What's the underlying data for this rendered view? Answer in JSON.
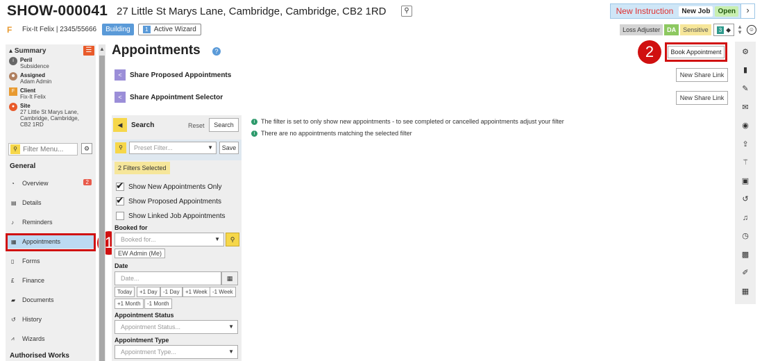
{
  "header": {
    "job_id": "SHOW-000041",
    "address": "27 Little St Marys Lane, Cambridge, Cambridge, CB2 1RD",
    "new_instruction": "New Instruction",
    "new_job": "New Job",
    "status": "Open",
    "client_line": "Fix-It Felix | 2345/55666",
    "building": "Building",
    "active_wizard": "Active Wizard",
    "active_wizard_num": "1",
    "tags": {
      "loss_adjuster": "Loss Adjuster",
      "da": "DA",
      "sensitive": "Sensitive",
      "count": "3"
    }
  },
  "summary": {
    "title": "Summary",
    "peril_label": "Peril",
    "peril_value": "Subsidence",
    "assigned_label": "Assigned",
    "assigned_value": "Adam Admin",
    "client_label": "Client",
    "client_value": "Fix-It Felix",
    "site_label": "Site",
    "site_line1": "27 Little St Marys Lane,",
    "site_line2": "Cambridge, Cambridge,",
    "site_line3": "CB2 1RD"
  },
  "filter_menu": {
    "placeholder": "Filter Menu..."
  },
  "nav": {
    "general": "General",
    "overview": "Overview",
    "overview_badge": "2",
    "details": "Details",
    "reminders": "Reminders",
    "appointments": "Appointments",
    "forms": "Forms",
    "finance": "Finance",
    "documents": "Documents",
    "history": "History",
    "wizards": "Wizards",
    "authorised_works": "Authorised Works"
  },
  "callouts": {
    "one": "1",
    "two": "2"
  },
  "main": {
    "title": "Appointments",
    "book_appointment": "Book Appointment",
    "share_proposed": "Share Proposed Appointments",
    "share_selector": "Share Appointment Selector",
    "new_share_link": "New Share Link",
    "info_1": "The filter is set to only show new appointments - to see completed or cancelled appointments adjust your filter",
    "info_2": "There are no appointments matching the selected filter"
  },
  "search": {
    "title": "Search",
    "reset": "Reset",
    "search_btn": "Search",
    "preset_placeholder": "Preset Filter...",
    "save": "Save",
    "filters_selected": "2 Filters Selected",
    "show_new": "Show New Appointments Only",
    "show_proposed": "Show Proposed Appointments",
    "show_linked": "Show Linked Job Appointments",
    "booked_for_label": "Booked for",
    "booked_for_placeholder": "Booked for...",
    "booked_chip": "EW Admin (Me)",
    "date_label": "Date",
    "date_placeholder": "Date...",
    "date_btns": [
      "Today",
      "+1 Day",
      "-1 Day",
      "+1 Week",
      "-1 Week",
      "+1 Month",
      "-1 Month"
    ],
    "status_label": "Appointment Status",
    "status_placeholder": "Appointment Status...",
    "type_label": "Appointment Type",
    "type_placeholder": "Appointment Type..."
  },
  "colors": {
    "accent_blue": "#5a9ad8",
    "callout_red": "#d01010",
    "filter_yellow": "#f6d74a"
  }
}
